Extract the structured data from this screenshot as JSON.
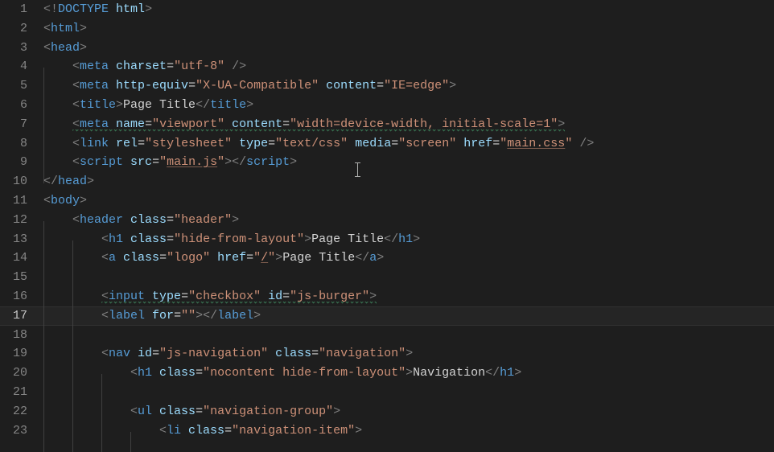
{
  "editor": {
    "activeLine": 17,
    "cursor": {
      "line": 9,
      "afterColPx": 400
    },
    "lines": [
      {
        "n": 1,
        "indent": 0,
        "tokens": [
          {
            "t": "br",
            "v": "<!"
          },
          {
            "t": "tag",
            "v": "DOCTYPE"
          },
          {
            "t": "txt",
            "v": " "
          },
          {
            "t": "attr",
            "v": "html"
          },
          {
            "t": "br",
            "v": ">"
          }
        ]
      },
      {
        "n": 2,
        "indent": 0,
        "tokens": [
          {
            "t": "br",
            "v": "<"
          },
          {
            "t": "tag",
            "v": "html"
          },
          {
            "t": "br",
            "v": ">"
          }
        ]
      },
      {
        "n": 3,
        "indent": 0,
        "tokens": [
          {
            "t": "br",
            "v": "<"
          },
          {
            "t": "tag",
            "v": "head"
          },
          {
            "t": "br",
            "v": ">"
          }
        ]
      },
      {
        "n": 4,
        "indent": 1,
        "tokens": [
          {
            "t": "br",
            "v": "<"
          },
          {
            "t": "tag",
            "v": "meta"
          },
          {
            "t": "txt",
            "v": " "
          },
          {
            "t": "attr",
            "v": "charset"
          },
          {
            "t": "txt",
            "v": "="
          },
          {
            "t": "str",
            "v": "\"utf-8\""
          },
          {
            "t": "txt",
            "v": " "
          },
          {
            "t": "br",
            "v": "/>"
          }
        ]
      },
      {
        "n": 5,
        "indent": 1,
        "tokens": [
          {
            "t": "br",
            "v": "<"
          },
          {
            "t": "tag",
            "v": "meta"
          },
          {
            "t": "txt",
            "v": " "
          },
          {
            "t": "attr",
            "v": "http-equiv"
          },
          {
            "t": "txt",
            "v": "="
          },
          {
            "t": "str",
            "v": "\"X-UA-Compatible\""
          },
          {
            "t": "txt",
            "v": " "
          },
          {
            "t": "attr",
            "v": "content"
          },
          {
            "t": "txt",
            "v": "="
          },
          {
            "t": "str",
            "v": "\"IE=edge\""
          },
          {
            "t": "br",
            "v": ">"
          }
        ]
      },
      {
        "n": 6,
        "indent": 1,
        "tokens": [
          {
            "t": "br",
            "v": "<"
          },
          {
            "t": "tag",
            "v": "title"
          },
          {
            "t": "br",
            "v": ">"
          },
          {
            "t": "txt",
            "v": "Page Title"
          },
          {
            "t": "br",
            "v": "</"
          },
          {
            "t": "tag",
            "v": "title"
          },
          {
            "t": "br",
            "v": ">"
          }
        ]
      },
      {
        "n": 7,
        "indent": 1,
        "wavy": true,
        "tokens": [
          {
            "t": "br",
            "v": "<"
          },
          {
            "t": "tag",
            "v": "meta"
          },
          {
            "t": "txt",
            "v": " "
          },
          {
            "t": "attr",
            "v": "name"
          },
          {
            "t": "txt",
            "v": "="
          },
          {
            "t": "str",
            "v": "\"viewport\""
          },
          {
            "t": "txt",
            "v": " "
          },
          {
            "t": "attr",
            "v": "content"
          },
          {
            "t": "txt",
            "v": "="
          },
          {
            "t": "str",
            "v": "\"width=device-width, initial-scale=1\""
          },
          {
            "t": "br",
            "v": ">"
          }
        ]
      },
      {
        "n": 8,
        "indent": 1,
        "tokens": [
          {
            "t": "br",
            "v": "<"
          },
          {
            "t": "tag",
            "v": "link"
          },
          {
            "t": "txt",
            "v": " "
          },
          {
            "t": "attr",
            "v": "rel"
          },
          {
            "t": "txt",
            "v": "="
          },
          {
            "t": "str",
            "v": "\"stylesheet\""
          },
          {
            "t": "txt",
            "v": " "
          },
          {
            "t": "attr",
            "v": "type"
          },
          {
            "t": "txt",
            "v": "="
          },
          {
            "t": "str",
            "v": "\"text/css\""
          },
          {
            "t": "txt",
            "v": " "
          },
          {
            "t": "attr",
            "v": "media"
          },
          {
            "t": "txt",
            "v": "="
          },
          {
            "t": "str",
            "v": "\"screen\""
          },
          {
            "t": "txt",
            "v": " "
          },
          {
            "t": "attr",
            "v": "href"
          },
          {
            "t": "txt",
            "v": "="
          },
          {
            "t": "str",
            "v": "\"",
            "post": ""
          },
          {
            "t": "str",
            "v": "main.css",
            "ul": true
          },
          {
            "t": "str",
            "v": "\""
          },
          {
            "t": "txt",
            "v": " "
          },
          {
            "t": "br",
            "v": "/>"
          }
        ]
      },
      {
        "n": 9,
        "indent": 1,
        "tokens": [
          {
            "t": "br",
            "v": "<"
          },
          {
            "t": "tag",
            "v": "script"
          },
          {
            "t": "txt",
            "v": " "
          },
          {
            "t": "attr",
            "v": "src"
          },
          {
            "t": "txt",
            "v": "="
          },
          {
            "t": "str",
            "v": "\""
          },
          {
            "t": "str",
            "v": "main.js",
            "ul": true
          },
          {
            "t": "str",
            "v": "\""
          },
          {
            "t": "br",
            "v": "></"
          },
          {
            "t": "tag",
            "v": "script"
          },
          {
            "t": "br",
            "v": ">"
          }
        ]
      },
      {
        "n": 10,
        "indent": 0,
        "tokens": [
          {
            "t": "br",
            "v": "</"
          },
          {
            "t": "tag",
            "v": "head"
          },
          {
            "t": "br",
            "v": ">"
          }
        ]
      },
      {
        "n": 11,
        "indent": 0,
        "tokens": [
          {
            "t": "br",
            "v": "<"
          },
          {
            "t": "tag",
            "v": "body"
          },
          {
            "t": "br",
            "v": ">"
          }
        ]
      },
      {
        "n": 12,
        "indent": 1,
        "tokens": [
          {
            "t": "br",
            "v": "<"
          },
          {
            "t": "tag",
            "v": "header"
          },
          {
            "t": "txt",
            "v": " "
          },
          {
            "t": "attr",
            "v": "class"
          },
          {
            "t": "txt",
            "v": "="
          },
          {
            "t": "str",
            "v": "\"header\""
          },
          {
            "t": "br",
            "v": ">"
          }
        ]
      },
      {
        "n": 13,
        "indent": 2,
        "tokens": [
          {
            "t": "br",
            "v": "<"
          },
          {
            "t": "tag",
            "v": "h1"
          },
          {
            "t": "txt",
            "v": " "
          },
          {
            "t": "attr",
            "v": "class"
          },
          {
            "t": "txt",
            "v": "="
          },
          {
            "t": "str",
            "v": "\"hide-from-layout\""
          },
          {
            "t": "br",
            "v": ">"
          },
          {
            "t": "txt",
            "v": "Page Title"
          },
          {
            "t": "br",
            "v": "</"
          },
          {
            "t": "tag",
            "v": "h1"
          },
          {
            "t": "br",
            "v": ">"
          }
        ]
      },
      {
        "n": 14,
        "indent": 2,
        "tokens": [
          {
            "t": "br",
            "v": "<"
          },
          {
            "t": "tag",
            "v": "a"
          },
          {
            "t": "txt",
            "v": " "
          },
          {
            "t": "attr",
            "v": "class"
          },
          {
            "t": "txt",
            "v": "="
          },
          {
            "t": "str",
            "v": "\"logo\""
          },
          {
            "t": "txt",
            "v": " "
          },
          {
            "t": "attr",
            "v": "href"
          },
          {
            "t": "txt",
            "v": "="
          },
          {
            "t": "str",
            "v": "\""
          },
          {
            "t": "str",
            "v": "/",
            "ul": true
          },
          {
            "t": "str",
            "v": "\""
          },
          {
            "t": "br",
            "v": ">"
          },
          {
            "t": "txt",
            "v": "Page Title"
          },
          {
            "t": "br",
            "v": "</"
          },
          {
            "t": "tag",
            "v": "a"
          },
          {
            "t": "br",
            "v": ">"
          }
        ]
      },
      {
        "n": 15,
        "indent": 2,
        "tokens": []
      },
      {
        "n": 16,
        "indent": 2,
        "wavy": true,
        "tokens": [
          {
            "t": "br",
            "v": "<"
          },
          {
            "t": "tag",
            "v": "input"
          },
          {
            "t": "txt",
            "v": " "
          },
          {
            "t": "attr",
            "v": "type"
          },
          {
            "t": "txt",
            "v": "="
          },
          {
            "t": "str",
            "v": "\"checkbox\""
          },
          {
            "t": "txt",
            "v": " "
          },
          {
            "t": "attr",
            "v": "id"
          },
          {
            "t": "txt",
            "v": "="
          },
          {
            "t": "str",
            "v": "\"js-burger\""
          },
          {
            "t": "br",
            "v": ">"
          }
        ]
      },
      {
        "n": 17,
        "indent": 2,
        "active": true,
        "tokens": [
          {
            "t": "br",
            "v": "<"
          },
          {
            "t": "tag",
            "v": "label"
          },
          {
            "t": "txt",
            "v": " "
          },
          {
            "t": "attr",
            "v": "for"
          },
          {
            "t": "txt",
            "v": "="
          },
          {
            "t": "str",
            "v": "\"\""
          },
          {
            "t": "br",
            "v": "></"
          },
          {
            "t": "tag",
            "v": "label"
          },
          {
            "t": "br",
            "v": ">"
          }
        ]
      },
      {
        "n": 18,
        "indent": 2,
        "tokens": []
      },
      {
        "n": 19,
        "indent": 2,
        "tokens": [
          {
            "t": "br",
            "v": "<"
          },
          {
            "t": "tag",
            "v": "nav"
          },
          {
            "t": "txt",
            "v": " "
          },
          {
            "t": "attr",
            "v": "id"
          },
          {
            "t": "txt",
            "v": "="
          },
          {
            "t": "str",
            "v": "\"js-navigation\""
          },
          {
            "t": "txt",
            "v": " "
          },
          {
            "t": "attr",
            "v": "class"
          },
          {
            "t": "txt",
            "v": "="
          },
          {
            "t": "str",
            "v": "\"navigation\""
          },
          {
            "t": "br",
            "v": ">"
          }
        ]
      },
      {
        "n": 20,
        "indent": 3,
        "tokens": [
          {
            "t": "br",
            "v": "<"
          },
          {
            "t": "tag",
            "v": "h1"
          },
          {
            "t": "txt",
            "v": " "
          },
          {
            "t": "attr",
            "v": "class"
          },
          {
            "t": "txt",
            "v": "="
          },
          {
            "t": "str",
            "v": "\"nocontent hide-from-layout\""
          },
          {
            "t": "br",
            "v": ">"
          },
          {
            "t": "txt",
            "v": "Navigation"
          },
          {
            "t": "br",
            "v": "</"
          },
          {
            "t": "tag",
            "v": "h1"
          },
          {
            "t": "br",
            "v": ">"
          }
        ]
      },
      {
        "n": 21,
        "indent": 3,
        "tokens": []
      },
      {
        "n": 22,
        "indent": 3,
        "tokens": [
          {
            "t": "br",
            "v": "<"
          },
          {
            "t": "tag",
            "v": "ul"
          },
          {
            "t": "txt",
            "v": " "
          },
          {
            "t": "attr",
            "v": "class"
          },
          {
            "t": "txt",
            "v": "="
          },
          {
            "t": "str",
            "v": "\"navigation-group\""
          },
          {
            "t": "br",
            "v": ">"
          }
        ]
      },
      {
        "n": 23,
        "indent": 4,
        "tokens": [
          {
            "t": "br",
            "v": "<"
          },
          {
            "t": "tag",
            "v": "li"
          },
          {
            "t": "txt",
            "v": " "
          },
          {
            "t": "attr",
            "v": "class"
          },
          {
            "t": "txt",
            "v": "="
          },
          {
            "t": "str",
            "v": "\"navigation-item\""
          },
          {
            "t": "br",
            "v": ">"
          }
        ]
      }
    ]
  }
}
